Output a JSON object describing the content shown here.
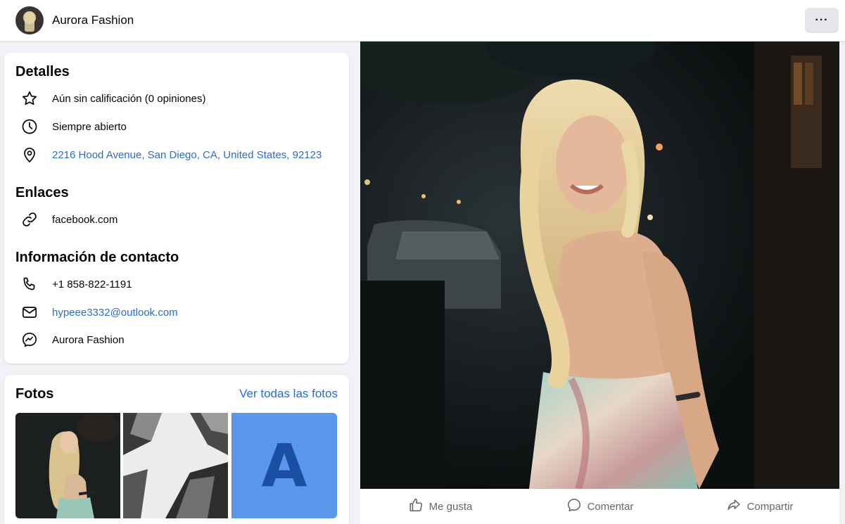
{
  "header": {
    "page_name": "Aurora Fashion",
    "more_label": "···"
  },
  "details": {
    "title": "Detalles",
    "rating": "Aún sin calificación (0 opiniones)",
    "hours": "Siempre abierto",
    "address": "2216 Hood Avenue, San Diego, CA, United States, 92123"
  },
  "links": {
    "title": "Enlaces",
    "website": "facebook.com"
  },
  "contact": {
    "title": "Información de contacto",
    "phone": "+1 858-822-1191",
    "email": "hypeee3332@outlook.com",
    "messenger": "Aurora Fashion"
  },
  "photos": {
    "title": "Fotos",
    "see_all": "Ver todas las fotos",
    "thumb3_letter": "A"
  },
  "actions": {
    "like": "Me gusta",
    "comment": "Comentar",
    "share": "Compartir"
  },
  "colors": {
    "link": "#2d6bd0",
    "background": "#f0f2f5",
    "card": "#ffffff",
    "secondary_text": "#65676b"
  }
}
